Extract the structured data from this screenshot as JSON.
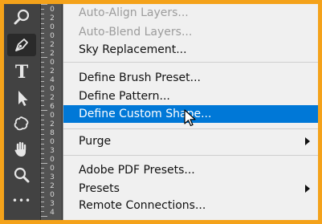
{
  "toolbar": {
    "tools": [
      {
        "icon": "magnifier-icon"
      },
      {
        "icon": "pen-tool-icon",
        "active": true
      },
      {
        "icon": "type-tool-icon",
        "glyph": "T"
      },
      {
        "icon": "path-selection-icon"
      },
      {
        "icon": "custom-shape-icon"
      },
      {
        "icon": "hand-tool-icon"
      },
      {
        "icon": "zoom-tool-icon"
      },
      {
        "icon": "more-tools-icon",
        "glyph": "•••"
      }
    ]
  },
  "ruler": {
    "digits": [
      "0",
      "2",
      "0",
      "0",
      "2",
      "2",
      "0",
      "2",
      "4",
      "0",
      "2",
      "6",
      "0",
      "2",
      "8",
      "0",
      "3",
      "0",
      "0",
      "3",
      "2",
      "0",
      "3",
      "4"
    ]
  },
  "menu": {
    "items": [
      {
        "label": "Auto-Align Layers...",
        "enabled": false
      },
      {
        "label": "Auto-Blend Layers...",
        "enabled": false
      },
      {
        "label": "Sky Replacement...",
        "enabled": true
      },
      {
        "label": "Define Brush Preset...",
        "enabled": true
      },
      {
        "label": "Define Pattern...",
        "enabled": true
      },
      {
        "label": "Define Custom Shape...",
        "enabled": true,
        "highlighted": true
      },
      {
        "label": "Purge",
        "enabled": true,
        "submenu": true
      },
      {
        "label": "Adobe PDF Presets...",
        "enabled": true
      },
      {
        "label": "Presets",
        "enabled": true,
        "submenu": true
      },
      {
        "label": "Remote Connections...",
        "enabled": true
      }
    ]
  },
  "colors": {
    "frame": "#f4a21a",
    "highlight": "#0078d7",
    "toolbar": "#424242",
    "menu_bg": "#f0f0f0",
    "disabled_text": "#9c9c9c"
  }
}
